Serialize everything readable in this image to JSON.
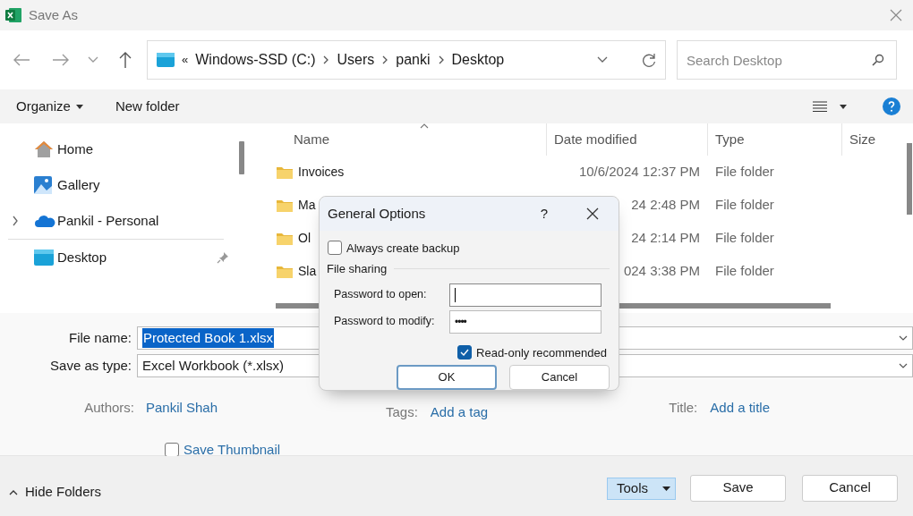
{
  "window": {
    "title": "Save As"
  },
  "address": {
    "overflow": "«",
    "crumbs": [
      "Windows-SSD (C:)",
      "Users",
      "panki",
      "Desktop"
    ]
  },
  "search": {
    "placeholder": "Search Desktop"
  },
  "toolbar": {
    "organize": "Organize",
    "new_folder": "New folder"
  },
  "nav": {
    "groups": [
      {
        "items": [
          {
            "kind": "home",
            "label": "Home",
            "expandable": false,
            "pinned": false
          },
          {
            "kind": "gallery",
            "label": "Gallery",
            "expandable": false,
            "pinned": false
          },
          {
            "kind": "cloud",
            "label": "Pankil - Personal",
            "expandable": true,
            "pinned": false
          }
        ]
      },
      {
        "items": [
          {
            "kind": "desktop",
            "label": "Desktop",
            "expandable": false,
            "pinned": true
          }
        ]
      }
    ]
  },
  "table": {
    "columns": [
      {
        "label": "Name",
        "sorted": true
      },
      {
        "label": "Date modified",
        "sorted": false
      },
      {
        "label": "Type",
        "sorted": false
      },
      {
        "label": "Size",
        "sorted": false
      }
    ],
    "rows": [
      {
        "name": "Invoices",
        "date": "10/6/2024 12:37 PM",
        "type": "File folder"
      },
      {
        "name": "Ma",
        "date": "24 2:48 PM",
        "type": "File folder"
      },
      {
        "name": "Ol",
        "date": "24 2:14 PM",
        "type": "File folder"
      },
      {
        "name": "Sla",
        "date": "024 3:38 PM",
        "type": "File folder"
      }
    ]
  },
  "form": {
    "file_name": {
      "label": "File name:",
      "value": "Protected Book 1.xlsx",
      "selected": true
    },
    "save_type": {
      "label": "Save as type:",
      "value": "Excel Workbook (*.xlsx)"
    },
    "authors": {
      "label": "Authors:",
      "value": "Pankil Shah"
    },
    "tags": {
      "label": "Tags:",
      "value": "Add a tag"
    },
    "title": {
      "label": "Title:",
      "value": "Add a title"
    },
    "save_thumbnail": {
      "label": "Save Thumbnail",
      "checked": false
    }
  },
  "footer": {
    "hide_folders": "Hide Folders",
    "tools": "Tools",
    "save": "Save",
    "cancel": "Cancel"
  },
  "dialog": {
    "title": "General Options",
    "help": "?",
    "backup": {
      "label": "Always create backup",
      "checked": false
    },
    "group": "File sharing",
    "password_open": {
      "label": "Password to open:",
      "focused": true
    },
    "password_modify": {
      "label": "Password to modify:",
      "value": "••••",
      "focused": false
    },
    "read_only": {
      "label": "Read-only recommended",
      "checked": true
    },
    "buttons": [
      {
        "label": "OK",
        "default": true
      },
      {
        "label": "Cancel",
        "default": false
      }
    ]
  }
}
